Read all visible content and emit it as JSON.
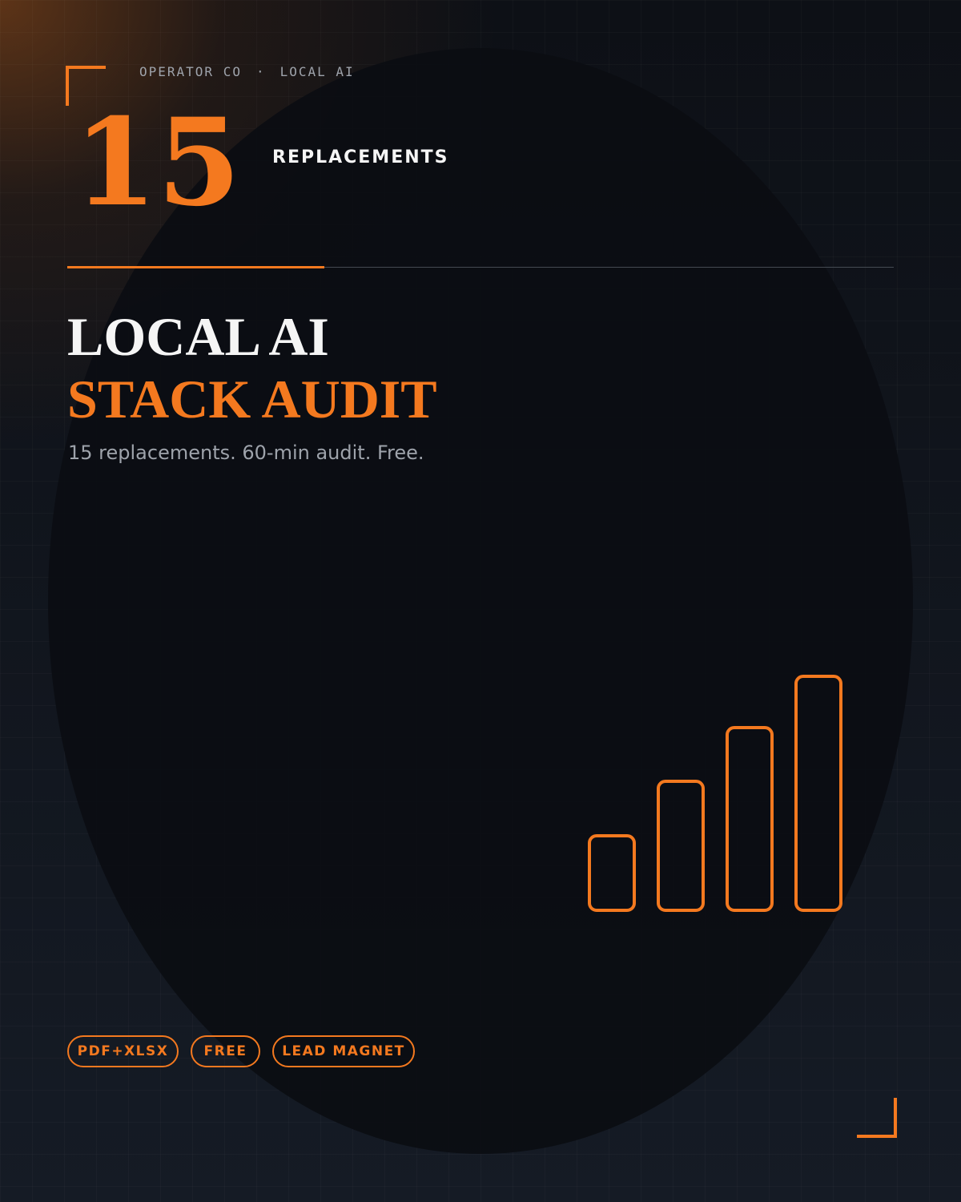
{
  "header": {
    "brand": "OPERATOR CO",
    "separator": "·",
    "category": "LOCAL AI"
  },
  "hero": {
    "number": "15",
    "number_label": "REPLACEMENTS"
  },
  "title": {
    "line1": "LOCAL AI",
    "line2": "STACK AUDIT"
  },
  "subtitle": "15 replacements. 60-min audit. Free.",
  "icon": "bar-chart-icon",
  "bar_levels": [
    0.32,
    0.55,
    0.78,
    1.0
  ],
  "tags": [
    "PDF+XLSX",
    "FREE",
    "LEAD MAGNET"
  ],
  "colors": {
    "accent": "#f4791f",
    "background": "#0e1118",
    "text": "#f5f5f5",
    "muted": "#9ea3ab"
  }
}
